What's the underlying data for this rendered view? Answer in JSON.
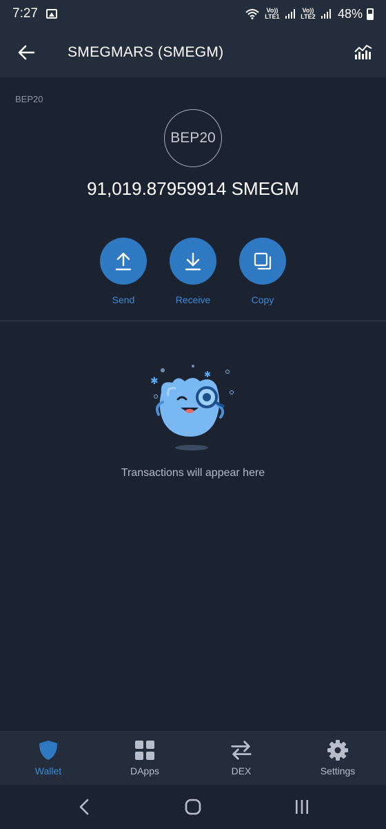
{
  "status_bar": {
    "time": "7:27",
    "sim1_label": "Vo)) LTE1",
    "sim2_label": "Vo)) LTE2",
    "battery_percent": "48%"
  },
  "header": {
    "title": "SMEGMARS (SMEGM)",
    "back_icon": "arrow-left-icon",
    "chart_icon": "chart-icon"
  },
  "token": {
    "network_label": "BEP20",
    "logo_text": "BEP20",
    "balance": "91,019.87959914 SMEGM"
  },
  "actions": [
    {
      "label": "Send",
      "icon": "upload-icon"
    },
    {
      "label": "Receive",
      "icon": "download-icon"
    },
    {
      "label": "Copy",
      "icon": "copy-icon"
    }
  ],
  "empty_state": {
    "message": "Transactions will appear here"
  },
  "bottom_nav": [
    {
      "label": "Wallet",
      "icon": "shield-icon",
      "active": true
    },
    {
      "label": "DApps",
      "icon": "grid-icon",
      "active": false
    },
    {
      "label": "DEX",
      "icon": "swap-icon",
      "active": false
    },
    {
      "label": "Settings",
      "icon": "gear-icon",
      "active": false
    }
  ],
  "colors": {
    "background": "#1b2330",
    "header": "#232d3b",
    "accent": "#2f79c3",
    "accent_text": "#3c8ad6"
  }
}
